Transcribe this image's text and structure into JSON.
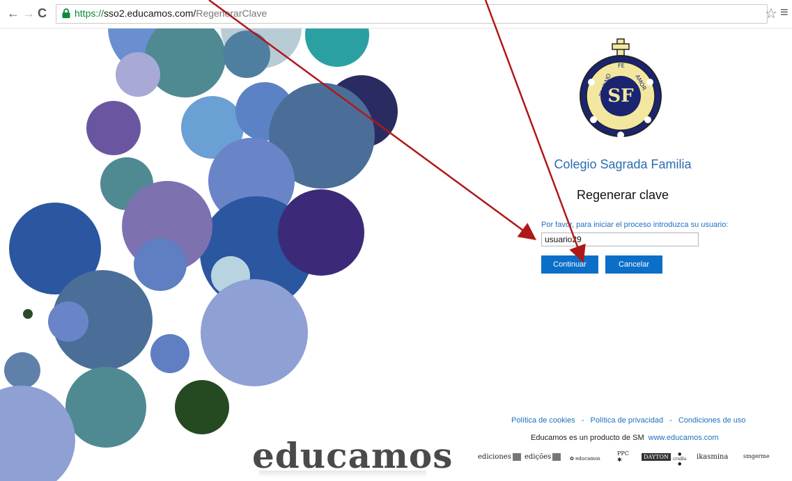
{
  "browser": {
    "url_scheme": "https://",
    "url_host": "sso2.educamos.com/",
    "url_path": "RegenerarClave",
    "nav_back": "←",
    "nav_forward": "→",
    "nav_reload": "C",
    "bookmark_icon": "star-icon",
    "menu_icon": "menu-icon"
  },
  "school": {
    "name": "Colegio Sagrada Familia",
    "emblem_text_left": "TRABAJO",
    "emblem_text_top": "FE",
    "emblem_text_right": "AMOR",
    "emblem_monogram": "SF"
  },
  "form": {
    "title": "Regenerar clave",
    "prompt": "Por favor, para iniciar el proceso introduzca su usuario:",
    "username_value": "usuario29",
    "continue_label": "Continuar",
    "cancel_label": "Cancelar"
  },
  "footer": {
    "cookies": "Política de cookies",
    "privacy": "Política de privacidad",
    "terms": "Condiciones de uso",
    "separator": "-",
    "product_text": "Educamos es un producto de SM",
    "product_link": "www.educamos.com",
    "brand": "educamos",
    "partner_logos": [
      "ediciones",
      "edições",
      "educamos",
      "PPC",
      "DAYTON",
      "cruilla",
      "ikasmina",
      "smgerme"
    ]
  },
  "colors": {
    "button": "#0b6fc7",
    "link": "#1e70c1",
    "arrow": "#b01818"
  }
}
